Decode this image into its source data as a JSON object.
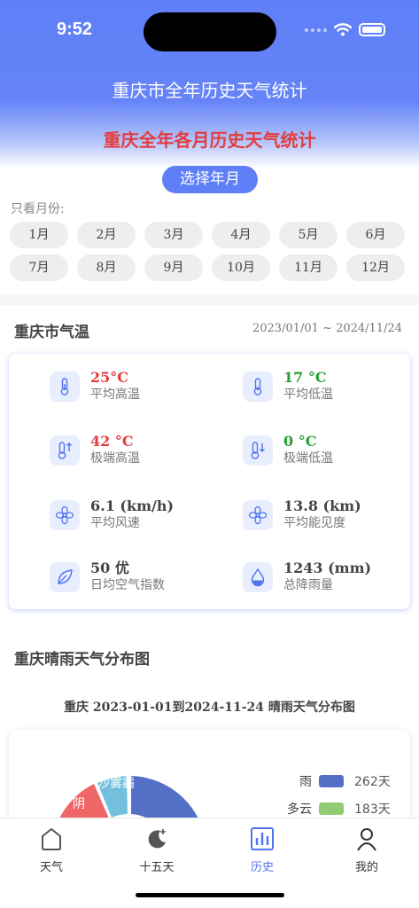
{
  "status_bar": {
    "time": "9:52"
  },
  "nav": {
    "title": "重庆市全年历史天气统计"
  },
  "page": {
    "heading": "重庆全年各月历史天气统计",
    "select_button": "选择年月",
    "filter_label": "只看月份:",
    "months": [
      "1月",
      "2月",
      "3月",
      "4月",
      "5月",
      "6月",
      "7月",
      "8月",
      "9月",
      "10月",
      "11月",
      "12月"
    ]
  },
  "temperature_section": {
    "title": "重庆市气温",
    "date_range": "2023/01/01 ~ 2024/11/24",
    "stats": [
      {
        "value": "25°C",
        "label": "平均高温",
        "icon": "thermometer-icon",
        "tone": "red"
      },
      {
        "value": "17 °C",
        "label": "平均低温",
        "icon": "thermometer-icon",
        "tone": "green"
      },
      {
        "value": "42 °C",
        "label": "极端高温",
        "icon": "thermometer-up-icon",
        "tone": "red"
      },
      {
        "value": "0 °C",
        "label": "极端低温",
        "icon": "thermometer-down-icon",
        "tone": "green"
      },
      {
        "value": "6.1 (km/h)",
        "label": "平均风速",
        "icon": "fan-icon",
        "tone": "gray"
      },
      {
        "value": "13.8 (km)",
        "label": "平均能见度",
        "icon": "fan-icon",
        "tone": "gray"
      },
      {
        "value": "50 优",
        "label": "日均空气指数",
        "icon": "leaf-icon",
        "tone": "gray"
      },
      {
        "value": "1243 (mm)",
        "label": "总降雨量",
        "icon": "water-drop-icon",
        "tone": "gray"
      }
    ]
  },
  "distribution_section": {
    "title": "重庆晴雨天气分布图",
    "subtitle": "重庆 2023-01-01到2024-11-24 晴雨天气分布图",
    "pie_labels": [
      "沙雾霾",
      "阴"
    ],
    "legend": [
      {
        "name": "雨",
        "count": "262天",
        "color": "#5470c6"
      },
      {
        "name": "多云",
        "count": "183天",
        "color": "#91cc75"
      }
    ]
  },
  "chart_data": {
    "type": "pie",
    "title": "重庆 2023-01-01到2024-11-24 晴雨天气分布图",
    "slices": [
      {
        "name": "雨",
        "days": 262,
        "color": "#5470c6"
      },
      {
        "name": "多云",
        "days": 183,
        "color": "#91cc75"
      }
    ],
    "partially_visible_labels": [
      "沙雾霾",
      "阴"
    ]
  },
  "tabbar": {
    "tabs": [
      {
        "label": "天气",
        "icon": "home-icon"
      },
      {
        "label": "十五天",
        "icon": "moon-icon"
      },
      {
        "label": "历史",
        "icon": "bar-chart-icon",
        "active": true
      },
      {
        "label": "我的",
        "icon": "user-icon"
      }
    ],
    "active_color": "#4f74f3"
  }
}
